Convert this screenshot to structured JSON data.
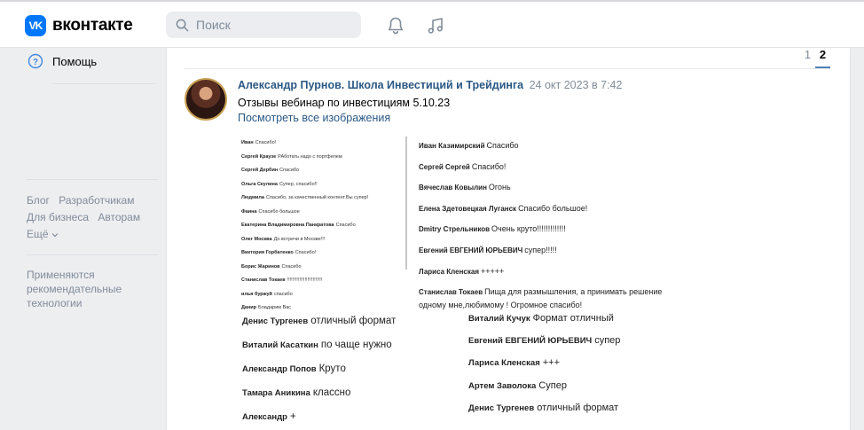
{
  "header": {
    "logo_mark": "VK",
    "logo_text": "вконтакте",
    "search_placeholder": "Поиск",
    "icons": [
      "search-icon",
      "bell-icon",
      "music-icon"
    ]
  },
  "sidebar": {
    "help_label": "Помощь",
    "footer_links": [
      "Блог",
      "Разработчикам",
      "Для бизнеса",
      "Авторам",
      "Ещё"
    ],
    "recommendation_note": "Применяются рекомендательные технологии"
  },
  "pager": {
    "pages": [
      "1",
      "2"
    ],
    "active": "2"
  },
  "post": {
    "author": "Александр Пурнов. Школа Инвестиций и Трейдинга",
    "date": "24 окт 2023 в 7:42",
    "text": "Отзывы вебинар по инвестициям 5.10.23",
    "see_all_link": "Посмотреть все изображения",
    "image": {
      "small_left": [
        {
          "name": "Иван",
          "text": "Спасибо!"
        },
        {
          "name": "Сергей Краузе",
          "text": "РАботать надо с портфелем"
        },
        {
          "name": "Сергей Дербин",
          "text": "Спасибо"
        },
        {
          "name": "Ольга Скулина",
          "text": "Супер, спасибо!!"
        },
        {
          "name": "Людмила",
          "text": "Спасибо, за качественный контент.Вы супер!"
        },
        {
          "name": "Фаина",
          "text": "Спасибо большое"
        },
        {
          "name": "Екатерина Владимировна Панкратова",
          "text": "Спасибо"
        },
        {
          "name": "Олег Москва",
          "text": "До встречи в Москве!!!"
        },
        {
          "name": "Виктория Горбатенко",
          "text": "Спасибо!"
        },
        {
          "name": "Борис Жаринов",
          "text": "Спасибо"
        },
        {
          "name": "Станислав Токаев",
          "text": "!!!!!!!!!!!!!!!!!!!!!!!!!!"
        },
        {
          "name": "илья буржуй",
          "text": "спасибо"
        },
        {
          "name": "Данир",
          "text": "Бладарим Вас"
        }
      ],
      "small_right": [
        {
          "name": "Иван Казимирский",
          "text": "Спасибо"
        },
        {
          "name": "Сергей Сергей",
          "text": "Спасибо!"
        },
        {
          "name": "Вячеслав Ковылин",
          "text": "Огонь"
        },
        {
          "name": "Елена Здетовецкая Луганск",
          "text": "Спасибо большое!"
        },
        {
          "name": "Dmitry Стрельников",
          "text": "Очень круто!!!!!!!!!!!!!"
        },
        {
          "name": "Евгений ЕВГЕНИЙ ЮРЬЕВИЧ",
          "text": "супер!!!!!"
        },
        {
          "name": "Лариса Кленская",
          "text": "+++++"
        },
        {
          "name": "Станислав Токаев",
          "text": "Пища для размышления, а принимать решение одному мне,любимому ! Огромное спасибо!"
        }
      ],
      "big_left": [
        {
          "name": "Денис Тургенев",
          "text": "отличный формат"
        },
        {
          "name": "Виталий Касаткин",
          "text": "по чаще нужно"
        },
        {
          "name": "Александр Попов",
          "text": "Круто"
        },
        {
          "name": "Тамара Аникина",
          "text": "классно"
        },
        {
          "name": "Александр",
          "text": "+"
        }
      ],
      "big_right": [
        {
          "name": "Виталий Кучук",
          "text": "Формат отличный"
        },
        {
          "name": "Евгений ЕВГЕНИЙ ЮРЬЕВИЧ",
          "text": "супер"
        },
        {
          "name": "Лариса Кленская",
          "text": "+++"
        },
        {
          "name": "Артем Заволока",
          "text": "Супер"
        },
        {
          "name": "Денис Тургенев",
          "text": "отличный формат"
        }
      ]
    }
  },
  "colors": {
    "accent": "#0077ff",
    "link": "#2a5885",
    "muted": "#818c99",
    "background": "#edeef0"
  }
}
